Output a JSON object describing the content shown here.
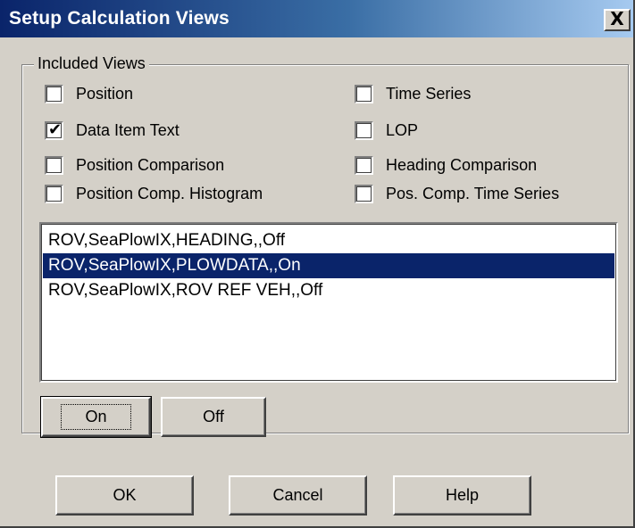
{
  "dialog": {
    "title": "Setup Calculation Views",
    "close_glyph": "X"
  },
  "included_views": {
    "label": "Included Views",
    "checkboxes": [
      {
        "label": "Position",
        "checked": false
      },
      {
        "label": "Time Series",
        "checked": false
      },
      {
        "label": "Data Item Text",
        "checked": true
      },
      {
        "label": "LOP",
        "checked": false
      },
      {
        "label": "Position Comparison",
        "checked": false
      },
      {
        "label": "Heading Comparison",
        "checked": false
      },
      {
        "label": "Position Comp. Histogram",
        "checked": false
      },
      {
        "label": "Pos. Comp. Time Series",
        "checked": false
      }
    ],
    "list": {
      "items": [
        "ROV,SeaPlowIX,HEADING,,Off",
        "ROV,SeaPlowIX,PLOWDATA,,On",
        "ROV,SeaPlowIX,ROV REF VEH,,Off"
      ],
      "selected_index": 1
    },
    "on_label": "On",
    "off_label": "Off"
  },
  "footer": {
    "ok_label": "OK",
    "cancel_label": "Cancel",
    "help_label": "Help"
  },
  "colors": {
    "selection": "#0a246a",
    "face": "#d4d0c8"
  }
}
